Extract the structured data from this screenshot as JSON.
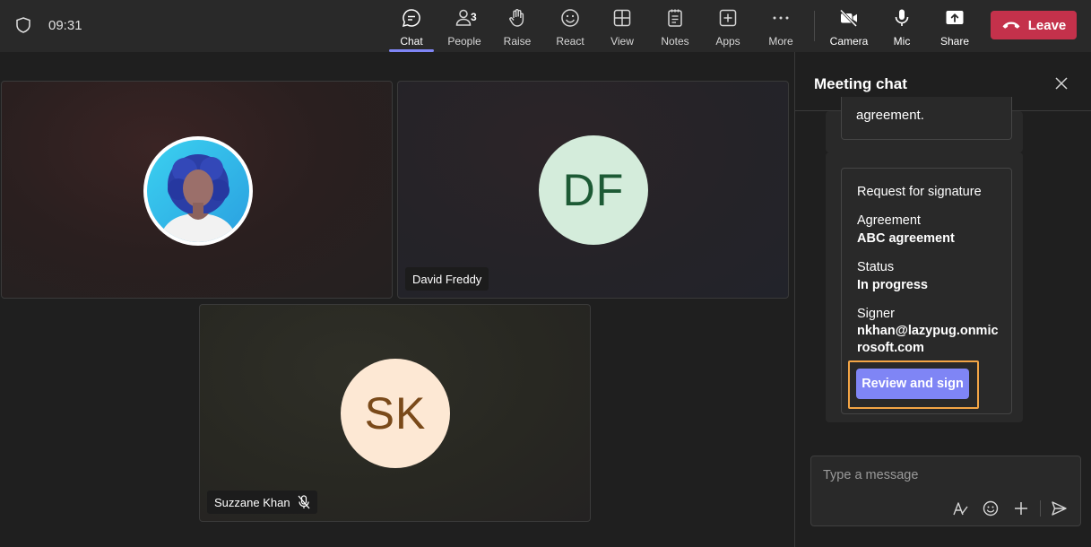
{
  "header": {
    "time": "09:31",
    "people_count": "3",
    "buttons": {
      "chat": "Chat",
      "people": "People",
      "raise": "Raise",
      "react": "React",
      "view": "View",
      "notes": "Notes",
      "apps": "Apps",
      "more": "More",
      "camera": "Camera",
      "mic": "Mic",
      "share": "Share"
    },
    "leave_label": "Leave",
    "active_tab": "Chat",
    "colors": {
      "accent": "#7f85f5",
      "leave": "#c4314b"
    }
  },
  "participants": [
    {
      "name": "",
      "initials": "",
      "avatar": "photo"
    },
    {
      "name": "David Freddy",
      "initials": "DF",
      "avatar_color": "#d4ecdb"
    },
    {
      "name": "Suzzane Khan",
      "initials": "SK",
      "avatar_color": "#fde8d4",
      "muted": true
    }
  ],
  "chat": {
    "title": "Meeting chat",
    "previous_message_tail": "agreement.",
    "card": {
      "heading": "Request for signature",
      "agreement_label": "Agreement",
      "agreement_value": "ABC agreement",
      "status_label": "Status",
      "status_value": "In progress",
      "signer_label": "Signer",
      "signer_value_line1": "nkhan@lazypug.onmic",
      "signer_value_line2": "rosoft.com",
      "action_label": "Review and sign"
    },
    "composer": {
      "placeholder": "Type a message"
    }
  }
}
